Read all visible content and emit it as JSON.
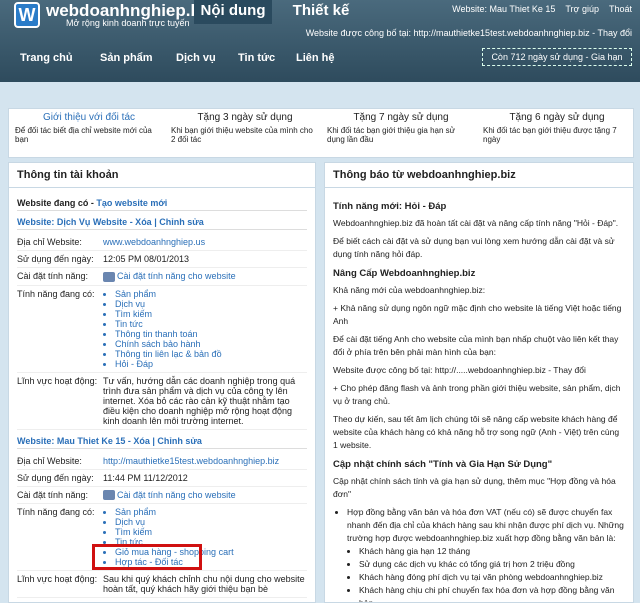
{
  "header": {
    "logo_letter": "W",
    "site": "webdoanhnghiep.biz",
    "slogan": "Mở rộng kinh doanh trực tuyến",
    "tab_content": "Nội dung",
    "tab_design": "Thiết kế",
    "website": "Website: Mau Thiet Ke 15",
    "help": "Trợ giúp",
    "exit": "Thoát",
    "published": "Website được công bố tại: http://mauthietke15test.webdoanhnghiep.biz - Thay đổi",
    "remain": "Còn 712 ngày sử dụng - Gia hạn"
  },
  "nav": [
    "Trang chủ",
    "Sản phẩm",
    "Dịch vụ",
    "Tin tức",
    "Liên hệ"
  ],
  "promos": [
    {
      "title": "Giới thiệu với đối tác",
      "desc": "Để đối tác biết địa chỉ website mới của bạn"
    },
    {
      "title": "Tặng 3 ngày sử dụng",
      "desc": "Khi bạn giới thiệu website của mình cho 2 đối tác"
    },
    {
      "title": "Tặng 7 ngày sử dụng",
      "desc": "Khi đối tác bạn giới thiệu gia hạn sử dụng lần đầu"
    },
    {
      "title": "Tặng 6 ngày sử dụng",
      "desc": "Khi đối tác bạn giới thiệu được tặng 7 ngày"
    }
  ],
  "left": {
    "title": "Thông tin tài khoản",
    "has_web": "Website đang có - ",
    "new_web": "Tạo website mới",
    "site1": {
      "title": "Website: Dịch Vụ Website - Xóa | Chỉnh sửa",
      "addr_l": "Địa chỉ Website:",
      "addr": "www.webdoanhnghiep.us",
      "until_l": "Sử dụng đến ngày:",
      "until": "12:05 PM 08/01/2013",
      "setup_l": "Cài đặt tính năng:",
      "setup": "Cài đặt tính năng cho website",
      "feat_l": "Tính năng đang có:",
      "features": [
        "Sản phẩm",
        "Dịch vụ",
        "Tìm kiếm",
        "Tin tức",
        "Thông tin thanh toán",
        "Chính sách bảo hành",
        "Thông tin liên lạc & bản đồ",
        "Hỏi - Đáp"
      ],
      "field_l": "Lĩnh vực hoạt động:",
      "field": "Tư vấn, hướng dẫn các doanh nghiệp trong quá trình đưa sản phẩm và dịch vụ của công ty lên internet. Xóa bỏ các rào cản kỹ thuật nhằm tạo điều kiện cho doanh nghiệp mở rộng hoạt động kinh doanh lên môi trường internet."
    },
    "site2": {
      "title": "Website: Mau Thiet Ke 15 - Xóa | Chỉnh sửa",
      "addr_l": "Địa chỉ Website:",
      "addr": "http://mauthietke15test.webdoanhnghiep.biz",
      "until_l": "Sử dụng đến ngày:",
      "until": "11:44 PM 11/12/2012",
      "setup_l": "Cài đặt tính năng:",
      "setup": "Cài đặt tính năng cho website",
      "feat_l": "Tính năng đang có:",
      "features": [
        "Sản phẩm",
        "Dịch vụ",
        "Tìm kiếm",
        "Tin tức",
        "Giỏ mua hàng - shopping cart",
        "Hợp tác - Đối tác"
      ],
      "field_l": "Lĩnh vực hoạt động:",
      "field": "Sau khi quý khách chỉnh chu nội dung cho website hoàn tất, quý khách hãy giới thiệu bạn bè"
    }
  },
  "right": {
    "title": "Thông báo từ webdoanhnghiep.biz",
    "h1": "Tính năng mới: Hỏi - Đáp",
    "p1": "Webdoanhnghiep.biz đã hoàn tất cài đặt và nâng cấp tính năng \"Hỏi - Đáp\".",
    "p2": "Để biết cách cài đặt và sử dụng bạn vui lòng xem hướng dẫn cài đặt và sử dụng tính năng hỏi đáp.",
    "h2": "Nâng Cấp Webdoanhnghiep.biz",
    "p3": " Khả năng mới của webdoanhnghiep.biz:",
    "p4": "+ Khả năng sử dụng ngôn ngữ mặc định cho website là tiếng Việt hoặc tiếng Anh",
    "p5": "Để cài đặt tiếng Anh cho website của mình bạn nhấp chuột vào liên kết thay đổi ở phía trên bên phải màn hình của bạn:",
    "p6": " Website được công bố tại: http://.....webdoanhnghiep.biz - Thay đổi",
    "p7": "+ Cho phép đăng flash và ảnh trong phần giới thiệu website, sản phẩm, dịch vụ ở trang chủ.",
    "p8": "Theo dự kiến, sau tết âm lịch chúng tôi sẽ nâng cấp website khách hàng để website của khách hàng có khả năng hỗ trợ song ngữ (Anh - Việt) trên cùng 1 website.",
    "h3": "Cập nhật chính sách \"Tính và Gia Hạn Sử Dụng\"",
    "p9": "Cập nhật chính sách tính và gia hạn sử dụng, thêm mục \"Hợp đồng và hóa đơn\"",
    "li": "Hợp đồng bằng văn bản và hóa đơn VAT (nếu có) sẽ được chuyển fax nhanh đến địa chỉ của khách hàng sau khi nhận được phí dịch vụ. Những trường hợp được webdoanhnghiep.biz xuất hợp đồng bằng văn bản là:",
    "sub": [
      "Khách hàng gia hạn 12 tháng",
      "Sử dụng các dịch vụ khác có tổng giá trị hơn 2 triệu đồng",
      "Khách hàng đóng phí dịch vụ tại văn phòng webdoanhnghiep.biz",
      "Khách hàng chịu chi phí chuyển fax hóa đơn và hợp đồng bằng văn bản"
    ]
  }
}
